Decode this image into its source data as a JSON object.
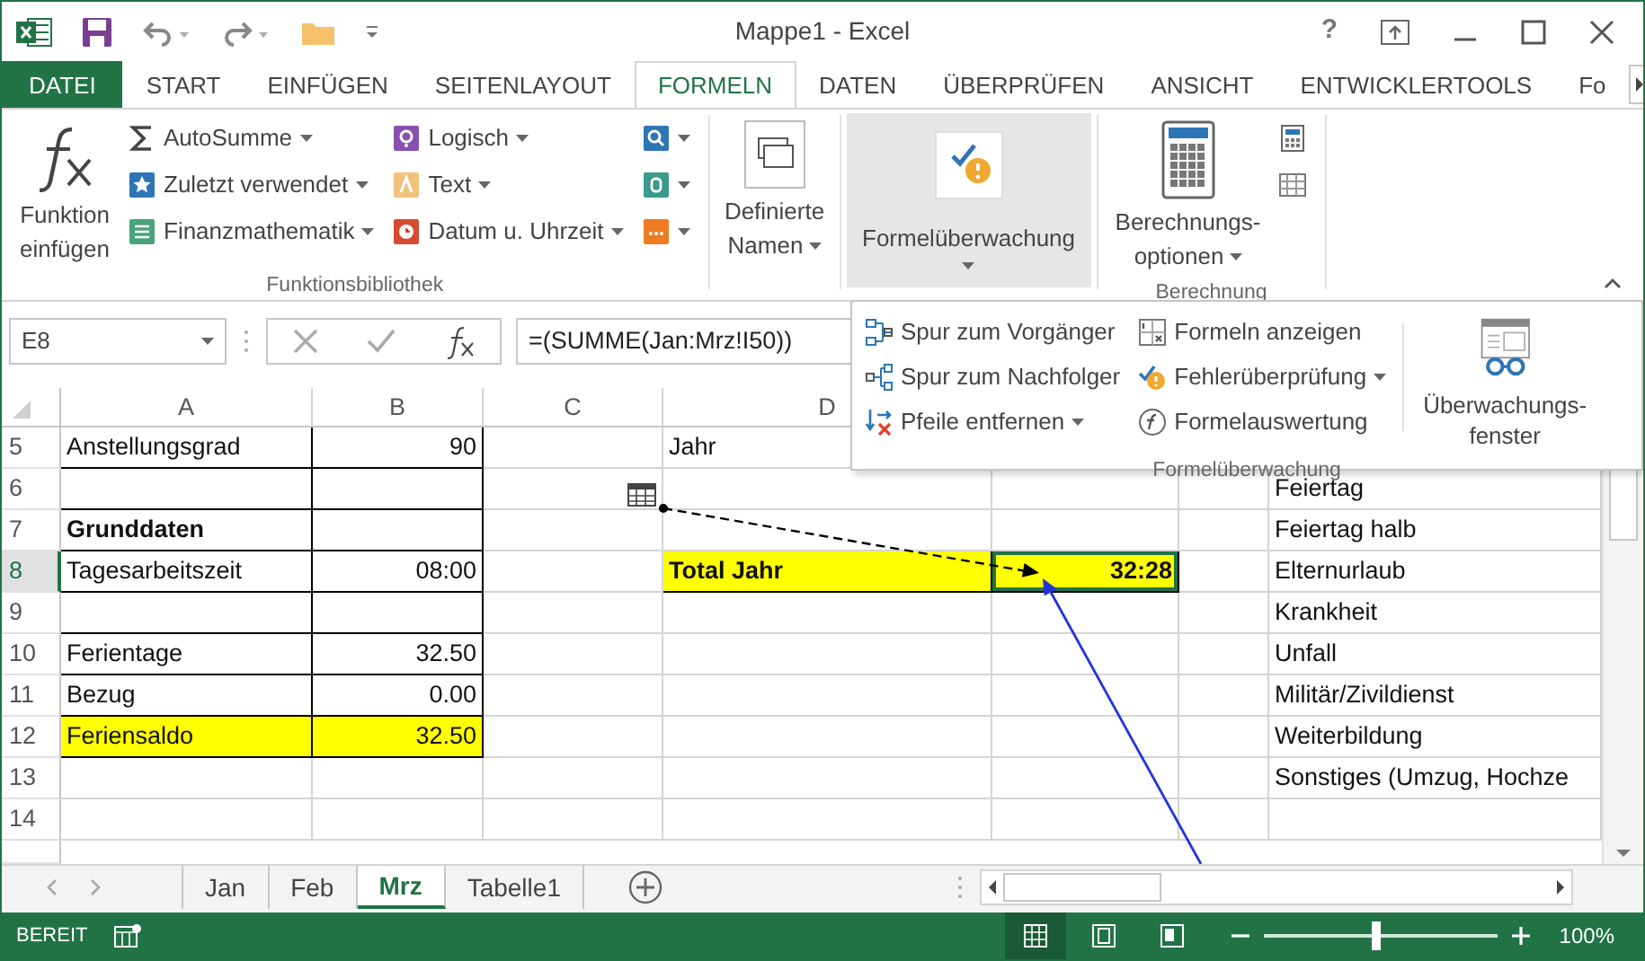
{
  "window": {
    "title": "Mappe1 - Excel",
    "help": "?"
  },
  "ribbon_tabs": [
    {
      "label": "DATEI",
      "kind": "file",
      "selected": false
    },
    {
      "label": "START",
      "kind": "tab",
      "selected": false
    },
    {
      "label": "EINFÜGEN",
      "kind": "tab",
      "selected": false
    },
    {
      "label": "SEITENLAYOUT",
      "kind": "tab",
      "selected": false
    },
    {
      "label": "FORMELN",
      "kind": "tab",
      "selected": true
    },
    {
      "label": "DATEN",
      "kind": "tab",
      "selected": false
    },
    {
      "label": "ÜBERPRÜFEN",
      "kind": "tab",
      "selected": false
    },
    {
      "label": "ANSICHT",
      "kind": "tab",
      "selected": false
    },
    {
      "label": "ENTWICKLERTOOLS",
      "kind": "tab",
      "selected": false
    },
    {
      "label": "Fo",
      "kind": "tab",
      "selected": false
    }
  ],
  "ribbon_groups": [
    {
      "label": "Funktionsbibliothek",
      "items": [
        {
          "kind": "large",
          "label": "Funktion einfügen",
          "dropdown": false,
          "pressed": false
        },
        {
          "kind": "small",
          "label": "AutoSumme",
          "dropdown": true
        },
        {
          "kind": "small",
          "label": "Zuletzt verwendet",
          "dropdown": true
        },
        {
          "kind": "small",
          "label": "Finanzmathematik",
          "dropdown": true
        },
        {
          "kind": "small",
          "label": "Logisch",
          "dropdown": true
        },
        {
          "kind": "small",
          "label": "Text",
          "dropdown": true
        },
        {
          "kind": "small",
          "label": "Datum u. Uhrzeit",
          "dropdown": true
        },
        {
          "kind": "icon",
          "dropdown": true
        },
        {
          "kind": "icon",
          "dropdown": true
        },
        {
          "kind": "icon",
          "dropdown": true
        }
      ]
    },
    {
      "items": [
        {
          "kind": "large",
          "label": "Definierte Namen",
          "dropdown": true,
          "pressed": false
        }
      ]
    },
    {
      "items": [
        {
          "kind": "large",
          "label": "Formelüberwachung",
          "dropdown": true,
          "pressed": true
        }
      ]
    },
    {
      "label": "Berechnung",
      "items": [
        {
          "kind": "large",
          "label": "Berechnungs-optionen",
          "dropdown": true,
          "pressed": false
        },
        {
          "kind": "icon",
          "dropdown": false
        },
        {
          "kind": "icon",
          "dropdown": false
        }
      ]
    }
  ],
  "watch_panel": {
    "label": "Formelüberwachung",
    "items": [
      {
        "kind": "small",
        "label": "Spur zum Vorgänger",
        "dropdown": false
      },
      {
        "kind": "small",
        "label": "Spur zum Nachfolger",
        "dropdown": false
      },
      {
        "kind": "small",
        "label": "Pfeile entfernen",
        "dropdown": true
      },
      {
        "kind": "small",
        "label": "Formeln anzeigen",
        "dropdown": false
      },
      {
        "kind": "small",
        "label": "Fehlerüberprüfung",
        "dropdown": true
      },
      {
        "kind": "small",
        "label": "Formelauswertung",
        "dropdown": false
      },
      {
        "kind": "large",
        "label": "Überwachungs-fenster",
        "dropdown": false,
        "pressed": false
      }
    ]
  },
  "formula_bar": {
    "name_box": "E8",
    "formula": "=(SUMME(Jan:Mrz!I50))"
  },
  "grid": {
    "columns": [
      {
        "label": "A"
      },
      {
        "label": "B"
      },
      {
        "label": "C"
      },
      {
        "label": "D"
      },
      {},
      {},
      {}
    ],
    "rows": [
      {
        "number": "5",
        "selected": false,
        "cells": [
          {
            "text": "Anstellungsgrad",
            "framed": true,
            "selected": false
          },
          {
            "text": "90",
            "kind": "number",
            "framed": true,
            "selected": false
          },
          {
            "selected": false
          },
          {
            "text": "Jahr",
            "selected": false
          },
          {},
          {},
          {}
        ]
      },
      {
        "number": "6",
        "selected": false,
        "cells": [
          {
            "framed": true,
            "selected": false
          },
          {
            "framed": true,
            "selected": false
          },
          {
            "kind": "trace_marker",
            "selected": false
          },
          {
            "selected": false
          },
          {
            "selected": false
          },
          {},
          {
            "text": "Feiertag",
            "selected": false
          }
        ]
      },
      {
        "number": "7",
        "selected": false,
        "cells": [
          {
            "text": "Grunddaten",
            "bold": true,
            "framed": true,
            "selected": false
          },
          {
            "framed": true,
            "selected": false
          },
          {
            "selected": false
          },
          {
            "selected": false
          },
          {
            "selected": false
          },
          {
            "selected": false
          },
          {
            "text": "Feiertag halb",
            "selected": false
          }
        ]
      },
      {
        "number": "8",
        "selected": true,
        "cells": [
          {
            "text": "Tagesarbeitszeit",
            "framed": true,
            "selected": false
          },
          {
            "text": "08:00",
            "kind": "number",
            "framed": true,
            "selected": false
          },
          {
            "selected": false
          },
          {
            "text": "Total Jahr",
            "bold": true,
            "highlight": true,
            "framed": true,
            "selected": false
          },
          {
            "text": "32:28",
            "kind": "number",
            "bold": true,
            "highlight": true,
            "framed": true,
            "selected": true
          },
          {
            "selected": false
          },
          {
            "text": "Elternurlaub",
            "selected": false
          }
        ]
      },
      {
        "number": "9",
        "selected": false,
        "cells": [
          {
            "framed": true,
            "selected": false
          },
          {
            "framed": true,
            "selected": false
          },
          {
            "selected": false
          },
          {
            "selected": false
          },
          {
            "selected": false
          },
          {
            "selected": false
          },
          {
            "text": "Krankheit",
            "selected": false
          }
        ]
      },
      {
        "number": "10",
        "selected": false,
        "cells": [
          {
            "text": "Ferientage",
            "framed": true,
            "selected": false
          },
          {
            "text": "32.50",
            "kind": "number",
            "framed": true,
            "selected": false
          },
          {
            "selected": false
          },
          {
            "selected": false
          },
          {
            "selected": false
          },
          {
            "selected": false
          },
          {
            "text": "Unfall",
            "selected": false
          }
        ]
      },
      {
        "number": "11",
        "selected": false,
        "cells": [
          {
            "text": "Bezug",
            "framed": true,
            "selected": false
          },
          {
            "text": "0.00",
            "kind": "number",
            "framed": true,
            "selected": false
          },
          {
            "selected": false
          },
          {
            "selected": false
          },
          {
            "selected": false
          },
          {
            "selected": false
          },
          {
            "text": "Militär/Zivildienst",
            "selected": false
          }
        ]
      },
      {
        "number": "12",
        "selected": false,
        "cells": [
          {
            "text": "Feriensaldo",
            "highlight": true,
            "framed": true,
            "selected": false
          },
          {
            "text": "32.50",
            "kind": "number",
            "highlight": true,
            "framed": true,
            "selected": false
          },
          {
            "selected": false
          },
          {
            "selected": false
          },
          {
            "selected": false
          },
          {
            "selected": false
          },
          {
            "text": "Weiterbildung",
            "selected": false
          }
        ]
      },
      {
        "number": "13",
        "selected": false,
        "cells": [
          {
            "selected": false
          },
          {
            "selected": false
          },
          {
            "selected": false
          },
          {
            "selected": false
          },
          {
            "selected": false
          },
          {
            "selected": false
          },
          {
            "text": "Sonstiges (Umzug, Hochze",
            "selected": false
          }
        ]
      },
      {
        "number": "14",
        "selected": false,
        "cells": [
          {
            "selected": false
          },
          {
            "selected": false
          },
          {
            "selected": false
          },
          {
            "selected": false
          },
          {
            "selected": false
          },
          {
            "selected": false
          },
          {
            "selected": false
          }
        ]
      }
    ]
  },
  "sheet_tabs": [
    {
      "label": "Jan",
      "selected": false
    },
    {
      "label": "Feb",
      "selected": false
    },
    {
      "label": "Mrz",
      "selected": true
    },
    {
      "label": "Tabelle1",
      "selected": false
    }
  ],
  "status_bar": {
    "text": "BEREIT",
    "views": [
      {
        "selected": true
      },
      {
        "selected": false
      },
      {
        "selected": false
      }
    ],
    "zoom_slider": {
      "level": 0.48
    },
    "zoom": "100%"
  }
}
